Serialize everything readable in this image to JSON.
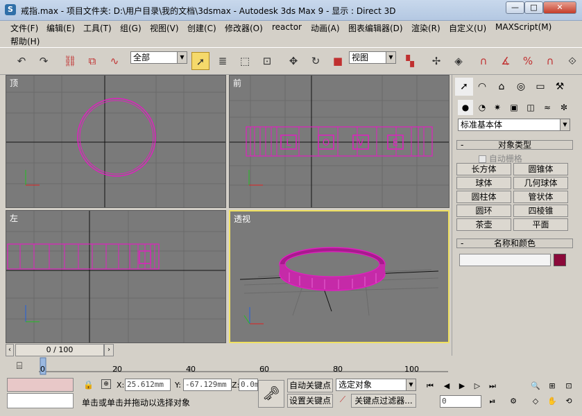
{
  "window": {
    "title": "戒指.max     - 项目文件夹: D:\\用户目录\\我的文档\\3dsmax     - Autodesk 3ds Max 9     - 显示 : Direct 3D",
    "min_label": "—",
    "max_label": "□",
    "close_label": "✕"
  },
  "menu": [
    "文件(F)",
    "编辑(E)",
    "工具(T)",
    "组(G)",
    "视图(V)",
    "创建(C)",
    "修改器(O)",
    "reactor",
    "动画(A)",
    "图表编辑器(D)",
    "渲染(R)",
    "自定义(U)",
    "MAXScript(M)",
    "帮助(H)"
  ],
  "toolbar": {
    "selection_filter": "全部",
    "ref_coord": "视图"
  },
  "viewports": {
    "top": "顶",
    "front": "前",
    "left": "左",
    "perspective": "透视",
    "front_letters": [
      "L",
      "O",
      "V",
      "E"
    ]
  },
  "command_panel": {
    "category": "标准基本体",
    "object_type_title": "对象类型",
    "autogrid": "自动栅格",
    "objects": [
      "长方体",
      "圆锥体",
      "球体",
      "几何球体",
      "圆柱体",
      "管状体",
      "圆环",
      "四棱锥",
      "茶壶",
      "平面"
    ],
    "name_color_title": "名称和颜色",
    "name_value": "",
    "object_color": "#8b0a3a"
  },
  "timeline": {
    "frame_display": "0 / 100",
    "ticks": [
      "0",
      "20",
      "40",
      "60",
      "80",
      "100"
    ]
  },
  "status": {
    "x_label": "X:",
    "x_value": "25.612mm",
    "y_label": "Y:",
    "y_value": "-67.129mm",
    "z_label": "Z:",
    "z_value": "0.0m",
    "prompt": "单击或单击并拖动以选择对象",
    "auto_key": "自动关键点",
    "set_key": "设置关键点",
    "key_mode": "选定对象",
    "key_filters": "关键点过滤器...",
    "current_frame": "0"
  },
  "colors": {
    "ring": "#e020c0",
    "viewport_bg": "#7a7a7a",
    "active_border": "#f0e060"
  }
}
